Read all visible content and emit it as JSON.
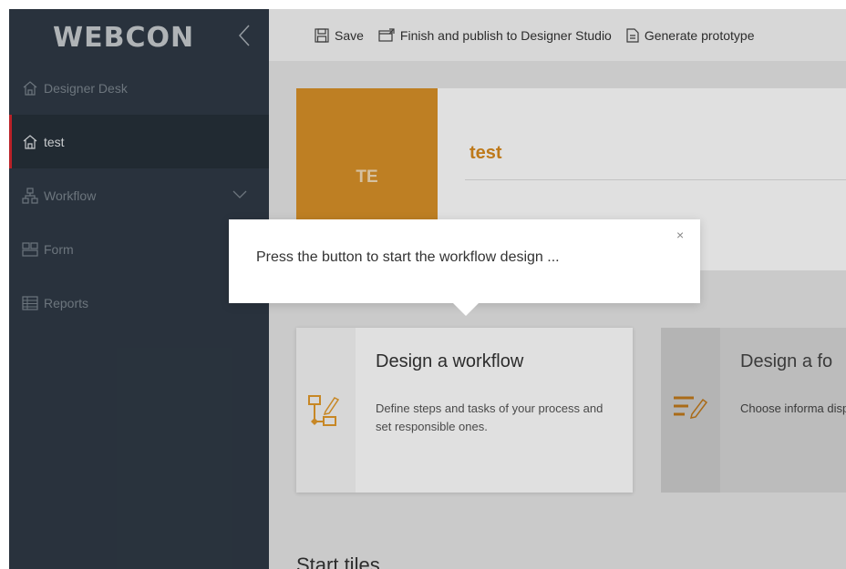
{
  "sidebar": {
    "logo": "WEBCON",
    "items": [
      {
        "label": "Designer Desk",
        "icon": "home-icon"
      },
      {
        "label": "test",
        "icon": "home-icon",
        "active": true
      },
      {
        "label": "Workflow",
        "icon": "workflow-icon",
        "expandable": true
      },
      {
        "label": "Form",
        "icon": "form-icon"
      },
      {
        "label": "Reports",
        "icon": "reports-icon",
        "expandable": true
      }
    ]
  },
  "toolbar": {
    "save_label": "Save",
    "finish_label": "Finish and publish to Designer Studio",
    "generate_label": "Generate prototype"
  },
  "header": {
    "avatar_initials": "TE",
    "process_name": "test",
    "accent": "#d99128"
  },
  "callout": {
    "text": "Press the button to start the workflow design ...",
    "close_glyph": "×"
  },
  "tiles": [
    {
      "title": "Design a workflow",
      "description": "Define steps and tasks of your process and set responsible ones."
    },
    {
      "title": "Design a fo",
      "description": "Choose informa display"
    }
  ],
  "section": {
    "start_tiles": "Start tiles"
  },
  "colors": {
    "sidebar": "#2f3a46",
    "active_marker": "#d4262e",
    "accent": "#d99128"
  }
}
